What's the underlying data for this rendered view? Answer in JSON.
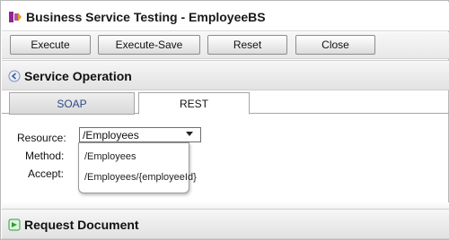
{
  "window": {
    "title": "Business Service Testing - EmployeeBS",
    "icon": "service-test-icon"
  },
  "toolbar": {
    "execute_label": "Execute",
    "execute_save_label": "Execute-Save",
    "reset_label": "Reset",
    "close_label": "Close"
  },
  "service_operation": {
    "title": "Service Operation",
    "icon": "collapse-arrow-icon",
    "tabs": [
      {
        "label": "SOAP",
        "active": false
      },
      {
        "label": "REST",
        "active": true
      }
    ],
    "form": {
      "resource_label": "Resource:",
      "method_label": "Method:",
      "accept_label": "Accept:",
      "resource_value": "/Employees",
      "resource_options": [
        "/Employees",
        "/Employees/{employeeId}"
      ]
    }
  },
  "request_document": {
    "title": "Request Document",
    "icon": "expand-arrow-icon"
  },
  "colors": {
    "tab_inactive_text": "#2b4a8a",
    "header_bg": "#e2e2e2",
    "icon_green": "#2e9e3a",
    "icon_purple": "#8b2a8e"
  }
}
